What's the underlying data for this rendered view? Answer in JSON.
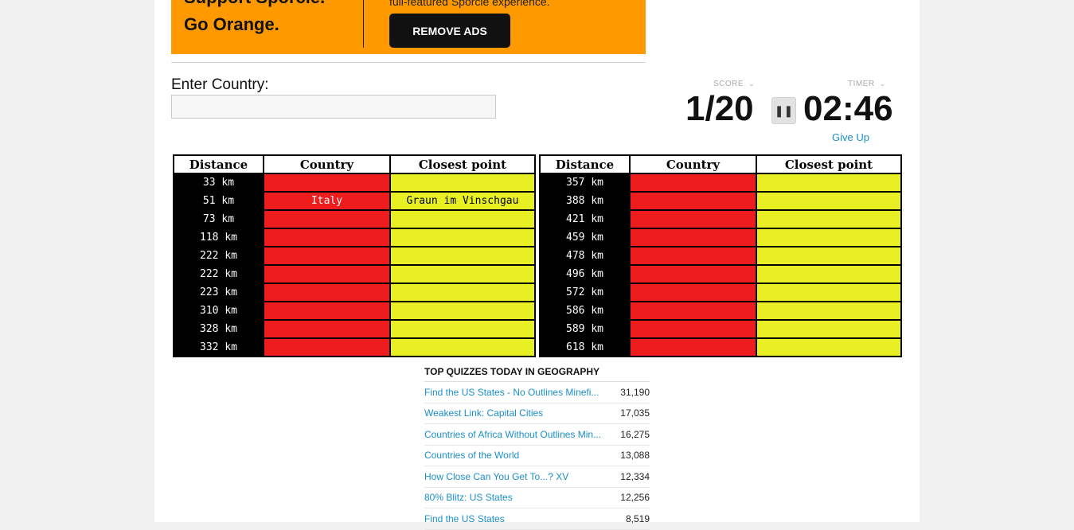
{
  "banner": {
    "slogan_line1": "Support Sporcle.",
    "slogan_line2": "Go Orange.",
    "subtitle": "full-featured Sporcle experience.",
    "remove_ads_label": "REMOVE ADS"
  },
  "entry": {
    "label": "Enter Country:",
    "value": "",
    "placeholder": ""
  },
  "scoreboard": {
    "score_label": "SCORE",
    "score": "1/20",
    "timer_label": "TIMER",
    "timer": "02:46",
    "pause_icon": "pause-icon",
    "give_up": "Give Up"
  },
  "table": {
    "headers": [
      "Distance",
      "Country",
      "Closest point"
    ],
    "left": [
      {
        "distance": "33 km",
        "country": "",
        "point": ""
      },
      {
        "distance": "51 km",
        "country": "Italy",
        "point": "Graun im Vinschgau"
      },
      {
        "distance": "73 km",
        "country": "",
        "point": ""
      },
      {
        "distance": "118 km",
        "country": "",
        "point": ""
      },
      {
        "distance": "222 km",
        "country": "",
        "point": ""
      },
      {
        "distance": "222 km",
        "country": "",
        "point": ""
      },
      {
        "distance": "223 km",
        "country": "",
        "point": ""
      },
      {
        "distance": "310 km",
        "country": "",
        "point": ""
      },
      {
        "distance": "328 km",
        "country": "",
        "point": ""
      },
      {
        "distance": "332 km",
        "country": "",
        "point": ""
      }
    ],
    "right": [
      {
        "distance": "357 km",
        "country": "",
        "point": ""
      },
      {
        "distance": "388 km",
        "country": "",
        "point": ""
      },
      {
        "distance": "421 km",
        "country": "",
        "point": ""
      },
      {
        "distance": "459 km",
        "country": "",
        "point": ""
      },
      {
        "distance": "478 km",
        "country": "",
        "point": ""
      },
      {
        "distance": "496 km",
        "country": "",
        "point": ""
      },
      {
        "distance": "572 km",
        "country": "",
        "point": ""
      },
      {
        "distance": "586 km",
        "country": "",
        "point": ""
      },
      {
        "distance": "589 km",
        "country": "",
        "point": ""
      },
      {
        "distance": "618 km",
        "country": "",
        "point": ""
      }
    ]
  },
  "top_quizzes": {
    "title": "TOP QUIZZES TODAY IN GEOGRAPHY",
    "items": [
      {
        "name": "Find the US States - No Outlines Minefi...",
        "count": "31,190"
      },
      {
        "name": "Weakest Link: Capital Cities",
        "count": "17,035"
      },
      {
        "name": "Countries of Africa Without Outlines Min...",
        "count": "16,275"
      },
      {
        "name": "Countries of the World",
        "count": "13,088"
      },
      {
        "name": "How Close Can You Get To...? XV",
        "count": "12,334"
      },
      {
        "name": "80% Blitz: US States",
        "count": "12,256"
      },
      {
        "name": "Find the US States",
        "count": "8,519"
      }
    ]
  },
  "colors": {
    "banner": "#ff9900",
    "country_cell": "#ee1c1c",
    "point_cell": "#e8ef22",
    "distance_cell": "#000000",
    "link": "#1b8fc7"
  }
}
